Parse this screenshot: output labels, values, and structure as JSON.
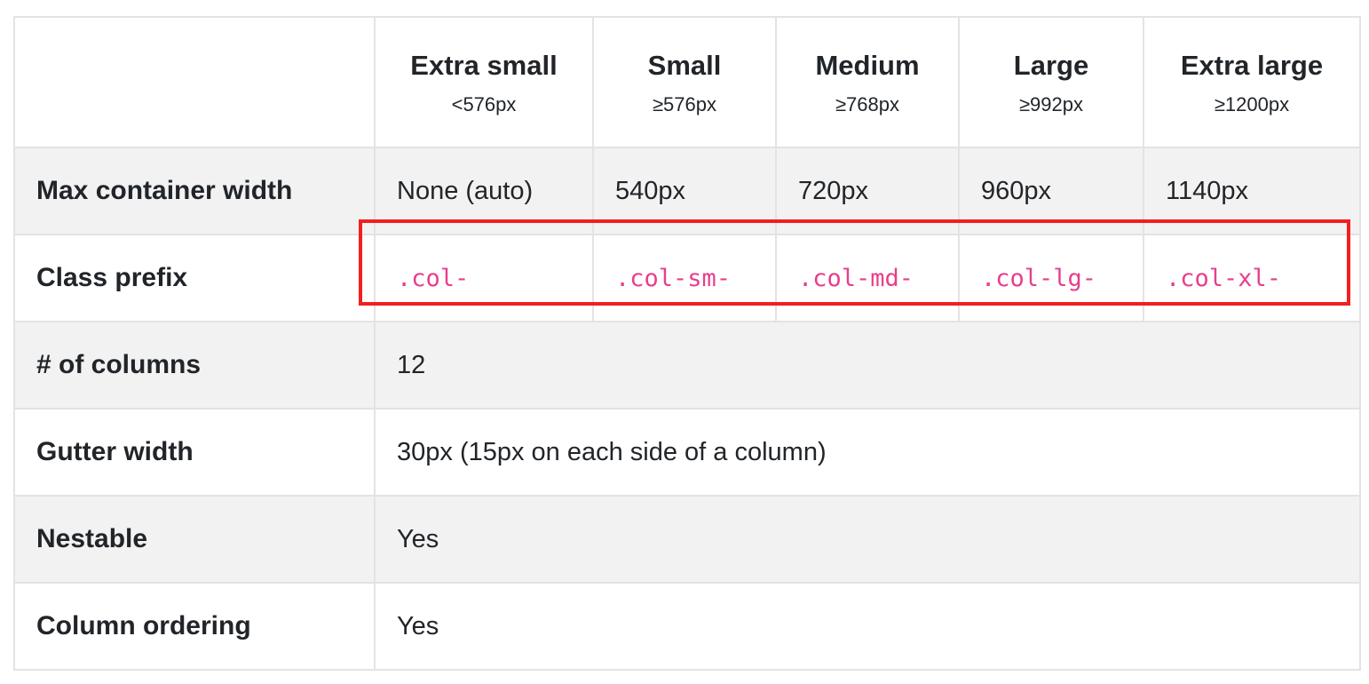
{
  "columns": [
    {
      "name": "Extra small",
      "size": "<576px"
    },
    {
      "name": "Small",
      "size": "≥576px"
    },
    {
      "name": "Medium",
      "size": "≥768px"
    },
    {
      "name": "Large",
      "size": "≥992px"
    },
    {
      "name": "Extra large",
      "size": "≥1200px"
    }
  ],
  "rows": {
    "max_width": {
      "label": "Max container width",
      "values": [
        "None (auto)",
        "540px",
        "720px",
        "960px",
        "1140px"
      ]
    },
    "class_prefix": {
      "label": "Class prefix",
      "values": [
        ".col-",
        ".col-sm-",
        ".col-md-",
        ".col-lg-",
        ".col-xl-"
      ]
    },
    "columns_count": {
      "label": "# of columns",
      "value": "12"
    },
    "gutter": {
      "label": "Gutter width",
      "value": "30px (15px on each side of a column)"
    },
    "nestable": {
      "label": "Nestable",
      "value": "Yes"
    },
    "ordering": {
      "label": "Column ordering",
      "value": "Yes"
    }
  },
  "colors": {
    "code_text": "#e83e8c",
    "highlight_border": "#f21f1f",
    "stripe": "#f2f2f2",
    "border": "#e3e3e3"
  }
}
